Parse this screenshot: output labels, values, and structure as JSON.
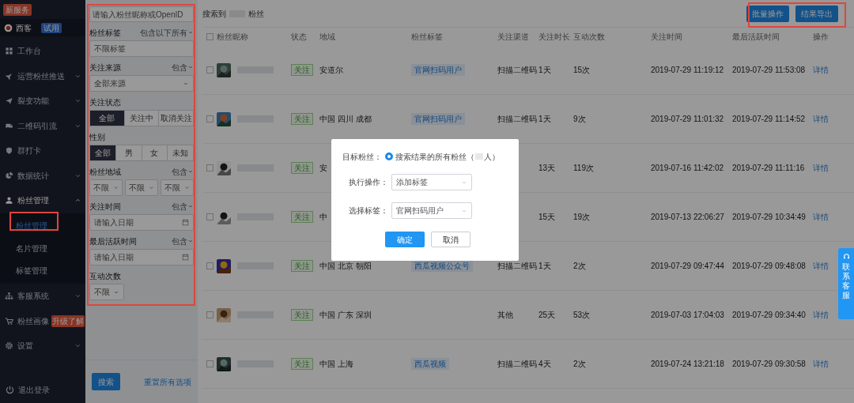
{
  "sidebar": {
    "top_badge": "新服务",
    "account": {
      "name": "西客",
      "tag": "试用"
    },
    "items": [
      {
        "label": "工作台"
      },
      {
        "label": "运营粉丝推送",
        "expandable": true,
        "expanded": false
      },
      {
        "label": "裂变功能",
        "expandable": true,
        "expanded": false
      },
      {
        "label": "二维码引流",
        "expandable": true,
        "expanded": false
      },
      {
        "label": "群打卡"
      },
      {
        "label": "数据统计",
        "expandable": true,
        "expanded": false
      },
      {
        "label": "粉丝管理",
        "expandable": true,
        "expanded": true,
        "children": [
          {
            "label": "粉丝管理",
            "selected": true
          },
          {
            "label": "名片管理",
            "selected": false
          },
          {
            "label": "标签管理",
            "selected": false
          }
        ]
      },
      {
        "label": "客服系统",
        "expandable": true,
        "expanded": false
      },
      {
        "label": "粉丝画像",
        "badge": "升级了解"
      },
      {
        "label": "设置",
        "expandable": true,
        "expanded": false
      }
    ],
    "logout": "退出登录"
  },
  "filters": {
    "search": {
      "placeholder": "请输入粉丝昵称或OpenID"
    },
    "sections": [
      {
        "kind": "field",
        "label": "粉丝标签",
        "mode": "包含以下所有",
        "placeholder": "不限标签"
      },
      {
        "kind": "select",
        "label": "关注来源",
        "mode": "包含",
        "value": "全部来源"
      },
      {
        "kind": "segmented",
        "label": "关注状态",
        "options": [
          {
            "label": "全部",
            "selected": true
          },
          {
            "label": "关注中",
            "selected": false
          },
          {
            "label": "取消关注",
            "selected": false
          }
        ]
      },
      {
        "kind": "segmented",
        "label": "性别",
        "options": [
          {
            "label": "全部",
            "selected": true
          },
          {
            "label": "男",
            "selected": false
          },
          {
            "label": "女",
            "selected": false
          },
          {
            "label": "未知",
            "selected": false
          }
        ]
      },
      {
        "kind": "selects",
        "label": "粉丝地域",
        "mode": "包含",
        "values": [
          "不限",
          "不限",
          "不限"
        ]
      },
      {
        "kind": "date",
        "label": "关注时间",
        "mode": "包含",
        "placeholder": "请输入日期"
      },
      {
        "kind": "date",
        "label": "最后活跃时间",
        "mode": "包含",
        "placeholder": "请输入日期"
      },
      {
        "kind": "small_select",
        "label": "互动次数",
        "value": "不限"
      }
    ],
    "search_button": "搜索",
    "reset_link": "重置所有选项"
  },
  "results": {
    "prefix": "搜索到",
    "suffix": "粉丝",
    "buttons": [
      "批量操作",
      "结果导出"
    ]
  },
  "table": {
    "all_checked": false,
    "columns": [
      "粉丝昵称",
      "状态",
      "地域",
      "粉丝标签",
      "关注渠道",
      "关注时长",
      "互动次数",
      "关注时间",
      "最后活跃时间",
      "操作"
    ],
    "rows": [
      {
        "checked": false,
        "status": "关注",
        "region": "安道尔",
        "tag": "官网扫码用户",
        "channel": "扫描二维码",
        "duration": "1天",
        "count": "15次",
        "follow_time": "2019-07-29 11:19:12",
        "last_active": "2019-07-29 11:53:08",
        "action": "详情"
      },
      {
        "checked": false,
        "status": "关注",
        "region": "中国 四川 成都",
        "tag": "官网扫码用户",
        "channel": "扫描二维码",
        "duration": "1天",
        "count": "9次",
        "follow_time": "2019-07-29 11:01:32",
        "last_active": "2019-07-29 11:14:52",
        "action": "详情"
      },
      {
        "checked": false,
        "status": "关注",
        "region": "安",
        "duration": "13天",
        "count": "119次",
        "follow_time": "2019-07-16 11:42:02",
        "last_active": "2019-07-29 11:11:16",
        "action": "详情"
      },
      {
        "checked": false,
        "status": "关注",
        "region": "中",
        "duration": "15天",
        "count": "19次",
        "follow_time": "2019-07-13 22:06:27",
        "last_active": "2019-07-29 10:34:49",
        "action": "详情"
      },
      {
        "checked": false,
        "status": "关注",
        "region": "中国 北京 朝阳",
        "tag": "西瓜视频公众号",
        "channel": "扫描二维码",
        "duration": "1天",
        "count": "2次",
        "follow_time": "2019-07-29 09:47:44",
        "last_active": "2019-07-29 09:48:08",
        "action": "详情"
      },
      {
        "checked": false,
        "status": "关注",
        "region": "中国 广东 深圳",
        "channel": "其他",
        "duration": "25天",
        "count": "53次",
        "follow_time": "2019-07-03 17:04:03",
        "last_active": "2019-07-29 09:34:40",
        "action": "详情"
      },
      {
        "checked": false,
        "status": "关注",
        "region": "中国 上海",
        "tag": "西瓜视频",
        "channel": "扫描二维码",
        "duration": "4天",
        "count": "2次",
        "follow_time": "2019-07-24 13:21:18",
        "last_active": "2019-07-29 09:30:58",
        "action": "详情"
      }
    ]
  },
  "dialog": {
    "target_label": "目标粉丝：",
    "target_option": {
      "label": "搜索结果的所有粉丝（",
      "suffix": "人）",
      "selected": true
    },
    "operation_label": "执行操作：",
    "operation_value": "添加标签",
    "tag_label": "选择标签：",
    "tag_value": "官网扫码用户",
    "confirm": "确定",
    "cancel": "取消"
  },
  "contact_button": "联系客服"
}
